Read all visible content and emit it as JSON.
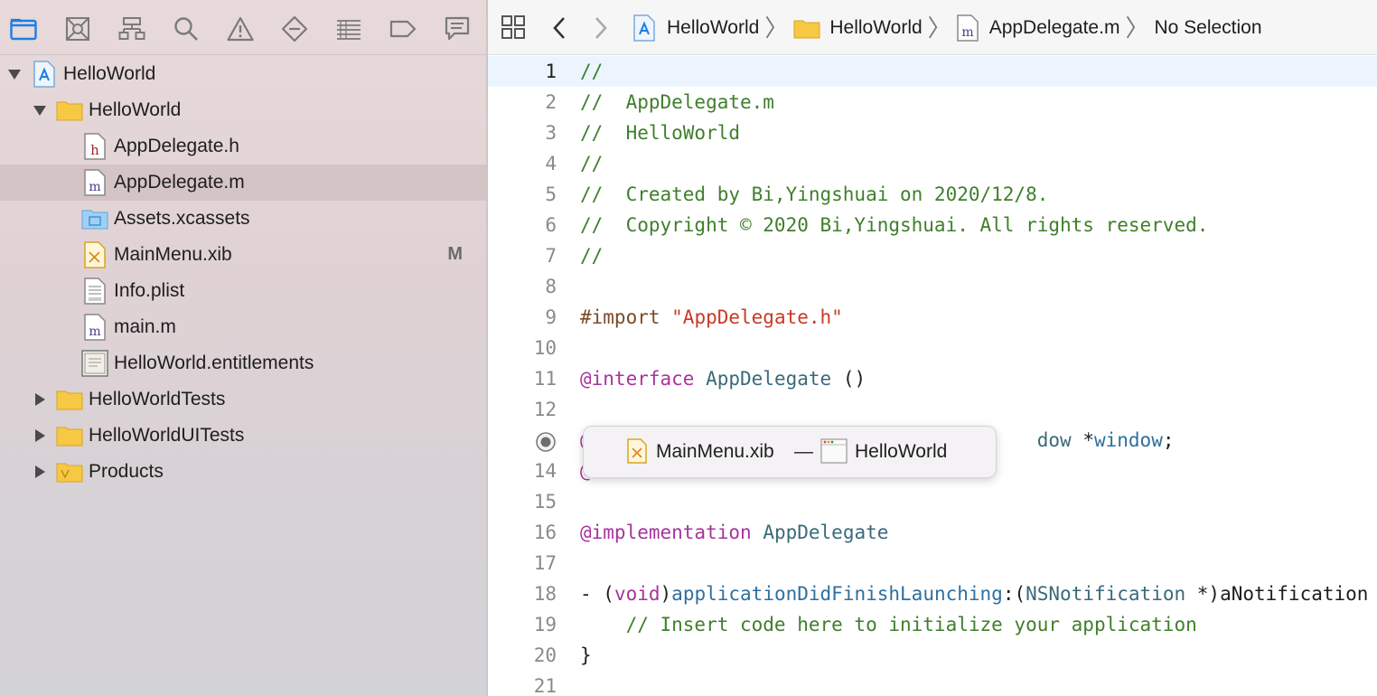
{
  "navigator": {
    "toolbar_icons": [
      "folder-icon",
      "source-control-icon",
      "hierarchy-icon",
      "search-icon",
      "warning-icon",
      "test-icon",
      "debug-icon",
      "breakpoint-icon",
      "report-icon"
    ],
    "tree": [
      {
        "label": "HelloWorld",
        "icon": "xcode-project-icon",
        "indent": 0,
        "disclosure": "open"
      },
      {
        "label": "HelloWorld",
        "icon": "folder-icon",
        "indent": 1,
        "disclosure": "open"
      },
      {
        "label": "AppDelegate.h",
        "icon": "header-file-icon",
        "indent": 2
      },
      {
        "label": "AppDelegate.m",
        "icon": "objc-file-icon",
        "indent": 2,
        "selected": true
      },
      {
        "label": "Assets.xcassets",
        "icon": "assets-folder-icon",
        "indent": 2
      },
      {
        "label": "MainMenu.xib",
        "icon": "xib-file-icon",
        "indent": 2,
        "badge": "M"
      },
      {
        "label": "Info.plist",
        "icon": "plist-file-icon",
        "indent": 2
      },
      {
        "label": "main.m",
        "icon": "objc-file-icon",
        "indent": 2
      },
      {
        "label": "HelloWorld.entitlements",
        "icon": "entitlements-file-icon",
        "indent": 2
      },
      {
        "label": "HelloWorldTests",
        "icon": "folder-icon",
        "indent": 1,
        "disclosure": "closed"
      },
      {
        "label": "HelloWorldUITests",
        "icon": "folder-icon",
        "indent": 1,
        "disclosure": "closed"
      },
      {
        "label": "Products",
        "icon": "products-folder-icon",
        "indent": 1,
        "disclosure": "closed"
      }
    ]
  },
  "jump_bar": {
    "crumbs": [
      "HelloWorld",
      "HelloWorld",
      "AppDelegate.m",
      "No Selection"
    ]
  },
  "editor": {
    "current_line": 1,
    "lines": [
      {
        "n": "1",
        "tokens": [
          {
            "t": "//",
            "c": "comment"
          }
        ]
      },
      {
        "n": "2",
        "tokens": [
          {
            "t": "//  AppDelegate.m",
            "c": "comment"
          }
        ]
      },
      {
        "n": "3",
        "tokens": [
          {
            "t": "//  HelloWorld",
            "c": "comment"
          }
        ]
      },
      {
        "n": "4",
        "tokens": [
          {
            "t": "//",
            "c": "comment"
          }
        ]
      },
      {
        "n": "5",
        "tokens": [
          {
            "t": "//  Created by Bi,Yingshuai on 2020/12/8.",
            "c": "comment"
          }
        ]
      },
      {
        "n": "6",
        "tokens": [
          {
            "t": "//  Copyright © 2020 Bi,Yingshuai. All rights reserved.",
            "c": "comment"
          }
        ]
      },
      {
        "n": "7",
        "tokens": [
          {
            "t": "//",
            "c": "comment"
          }
        ]
      },
      {
        "n": "8",
        "tokens": []
      },
      {
        "n": "9",
        "tokens": [
          {
            "t": "#import ",
            "c": "keyword-plain"
          },
          {
            "t": "\"AppDelegate.h\"",
            "c": "string"
          }
        ]
      },
      {
        "n": "10",
        "tokens": []
      },
      {
        "n": "11",
        "tokens": [
          {
            "t": "@interface",
            "c": "keyword"
          },
          {
            "t": " ",
            "c": "plain"
          },
          {
            "t": "AppDelegate",
            "c": "type"
          },
          {
            "t": " ()",
            "c": "plain"
          }
        ]
      },
      {
        "n": "12",
        "tokens": []
      },
      {
        "n": "",
        "breakpoint": true,
        "tokens": [
          {
            "t": "@",
            "c": "keyword"
          },
          {
            "t": "                                       ",
            "c": "plain"
          },
          {
            "t": "dow ",
            "c": "type"
          },
          {
            "t": "*",
            "c": "plain"
          },
          {
            "t": "window",
            "c": "method"
          },
          {
            "t": ";",
            "c": "plain"
          }
        ]
      },
      {
        "n": "14",
        "tokens": [
          {
            "t": "@end",
            "c": "keyword"
          }
        ]
      },
      {
        "n": "15",
        "tokens": []
      },
      {
        "n": "16",
        "tokens": [
          {
            "t": "@implementation",
            "c": "keyword"
          },
          {
            "t": " ",
            "c": "plain"
          },
          {
            "t": "AppDelegate",
            "c": "type"
          }
        ]
      },
      {
        "n": "17",
        "tokens": []
      },
      {
        "n": "18",
        "tokens": [
          {
            "t": "- (",
            "c": "plain"
          },
          {
            "t": "void",
            "c": "keyword"
          },
          {
            "t": ")",
            "c": "plain"
          },
          {
            "t": "applicationDidFinishLaunching",
            "c": "method"
          },
          {
            "t": ":(",
            "c": "plain"
          },
          {
            "t": "NSNotification",
            "c": "type"
          },
          {
            "t": " *)aNotification {",
            "c": "plain"
          }
        ]
      },
      {
        "n": "19",
        "tokens": [
          {
            "t": "    // Insert code here to initialize your application",
            "c": "comment"
          }
        ]
      },
      {
        "n": "20",
        "tokens": [
          {
            "t": "}",
            "c": "plain"
          }
        ]
      },
      {
        "n": "21",
        "tokens": []
      }
    ]
  },
  "popup": {
    "file": "MainMenu.xib",
    "dash": "—",
    "target": "HelloWorld"
  },
  "colors": {
    "comment": "#3f7f2b",
    "keyword": "#a7339d",
    "string": "#c73a27",
    "type": "#3a6a7a",
    "method": "#2f6f9f",
    "selection": "#d5c4c6",
    "accent": "#1a7ee6"
  }
}
